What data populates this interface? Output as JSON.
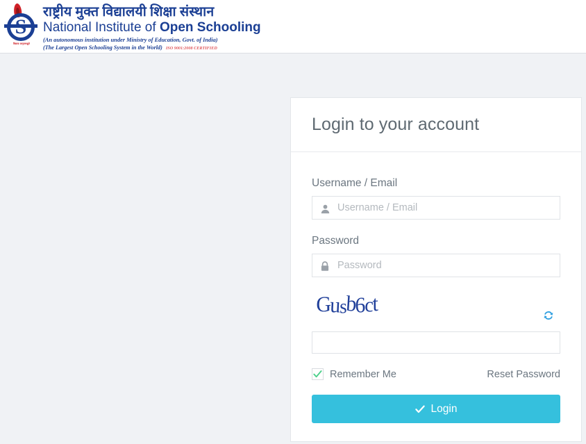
{
  "header": {
    "logo": {
      "emblem_icon": "nios-emblem-icon",
      "emblem_caption": "विद्यया अमृतमश्नुते",
      "hindi_title": "राष्ट्रीय मुक्त विद्यालयी शिक्षा संस्थान",
      "english_title_light": "National Institute of ",
      "english_title_bold": "Open Schooling",
      "subtitle_1": "(An autonomous institution under Ministry of Education, Govt. of India)",
      "subtitle_2": "(The Largest Open Schooling System in the World)",
      "iso_text": "ISO 9001:2008 CERTIFIED"
    }
  },
  "login_card": {
    "title": "Login to your account",
    "username": {
      "label": "Username / Email",
      "placeholder": "Username / Email",
      "value": "",
      "icon": "user-icon"
    },
    "password": {
      "label": "Password",
      "placeholder": "Password",
      "value": "",
      "icon": "lock-icon"
    },
    "captcha": {
      "text": "Gusb6ct",
      "characters": [
        "G",
        "u",
        "s",
        "b",
        "6",
        "c",
        "t"
      ],
      "refresh_icon": "refresh-icon",
      "input_placeholder": "",
      "input_value": "",
      "text_color": "#21409a"
    },
    "remember_me": {
      "label": "Remember Me",
      "checked": true,
      "check_color": "#4cd08b"
    },
    "reset_password_label": "Reset Password",
    "login_button": {
      "label": "Login",
      "icon": "check-icon",
      "color": "#35c0dd"
    }
  },
  "colors": {
    "page_background": "#f0f2f5",
    "header_background": "#ffffff",
    "card_background": "#ffffff",
    "brand_blue": "#1b3f94",
    "brand_red": "#cf2027",
    "accent": "#35c0dd"
  }
}
